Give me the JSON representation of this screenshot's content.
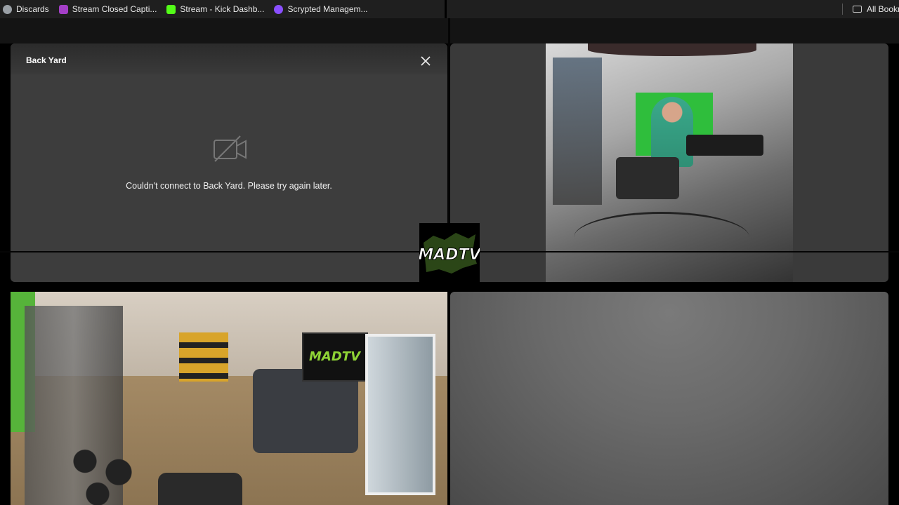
{
  "bookmarks": {
    "items": [
      {
        "label": "Discards",
        "icon": "discards-icon",
        "color": "#9aa0a6"
      },
      {
        "label": "Stream Closed Capti...",
        "icon": "closed-captions-icon",
        "color": "#a43fc7"
      },
      {
        "label": "Stream - Kick Dashb...",
        "icon": "kick-icon",
        "color": "#53fc18"
      },
      {
        "label": "Scrypted Managem...",
        "icon": "scrypted-icon",
        "color": "#8a4fff"
      }
    ],
    "all_bookmarks": "All Bookn"
  },
  "cameras": {
    "backyard": {
      "title": "Back Yard",
      "error_message": "Couldn't connect to Back Yard. Please try again later."
    },
    "logo_text": "MADTV"
  },
  "colors": {
    "accent_green": "#8fd436",
    "panel_bg": "#3d3d3d"
  }
}
